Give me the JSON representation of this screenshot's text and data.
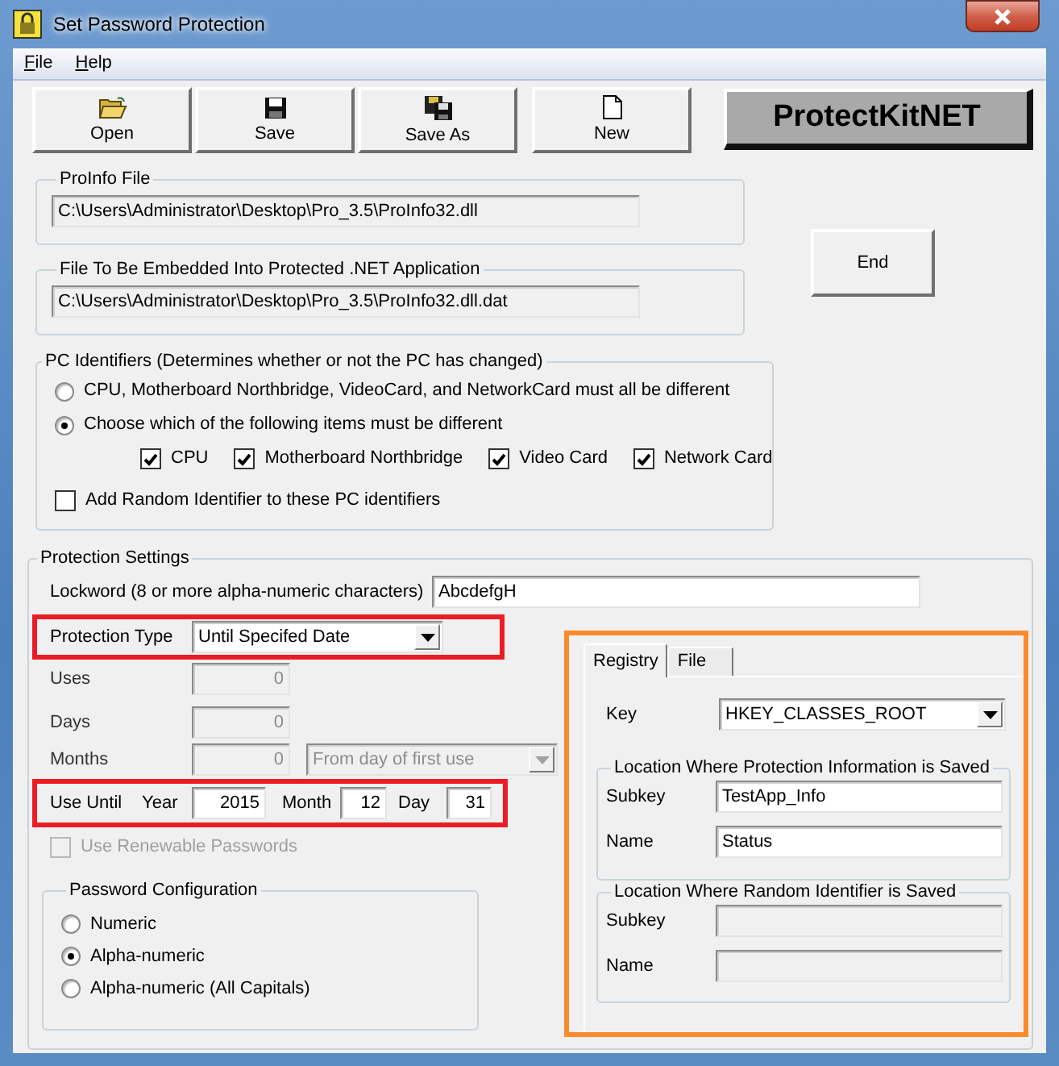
{
  "window": {
    "title": "Set Password Protection"
  },
  "menu": [
    {
      "label": "File"
    },
    {
      "label": "Help"
    }
  ],
  "toolbar": [
    {
      "label": "Open",
      "kind": "open"
    },
    {
      "label": "Save",
      "kind": "save"
    },
    {
      "label": "Save As",
      "kind": "save_as"
    },
    {
      "label": "New",
      "kind": "new"
    }
  ],
  "logo": "ProtectKitNET",
  "proinfo_file": {
    "label": "ProInfo File",
    "value": "C:\\Users\\Administrator\\Desktop\\Pro_3.5\\ProInfo32.dll"
  },
  "embedded_file": {
    "label": "File To Be Embedded Into Protected .NET Application",
    "value": "C:\\Users\\Administrator\\Desktop\\Pro_3.5\\ProInfo32.dll.dat"
  },
  "end_button": "End",
  "pc_identifiers": {
    "label": "PC Identifiers (Determines whether or not the PC has changed)",
    "options": [
      {
        "label": "CPU, Motherboard Northbridge, VideoCard, and NetworkCard must all be different",
        "selected": false
      },
      {
        "label": "Choose which of the following items must be different",
        "selected": true
      }
    ],
    "items": [
      {
        "label": "CPU",
        "checked": true
      },
      {
        "label": "Motherboard Northbridge",
        "checked": true
      },
      {
        "label": "Video Card",
        "checked": true
      },
      {
        "label": "Network Card",
        "checked": true
      }
    ],
    "random_identifier": {
      "label": "Add Random Identifier to these PC identifiers",
      "checked": false
    }
  },
  "protection_settings": {
    "label": "Protection Settings",
    "lockword": {
      "label": "Lockword (8 or more alpha-numeric characters)",
      "value": "AbcdefgH"
    },
    "protection_type": {
      "label": "Protection Type",
      "value": "Until Specifed Date",
      "highlighted": true
    },
    "uses": {
      "label": "Uses",
      "value": "0",
      "disabled": true
    },
    "days": {
      "label": "Days",
      "value": "0",
      "disabled": true
    },
    "months": {
      "label": "Months",
      "value": "0",
      "disabled": true,
      "basis": "From day of first use"
    },
    "use_until": {
      "label": "Use Until",
      "highlighted": true,
      "year_label": "Year",
      "year": "2015",
      "month_label": "Month",
      "month": "12",
      "day_label": "Day",
      "day": "31"
    },
    "renewable": {
      "label": "Use Renewable Passwords",
      "checked": false,
      "disabled": true
    },
    "password_configuration": {
      "label": "Password Configuration",
      "options": [
        {
          "label": "Numeric",
          "selected": false
        },
        {
          "label": "Alpha-numeric",
          "selected": true
        },
        {
          "label": "Alpha-numeric (All Capitals)",
          "selected": false
        }
      ]
    }
  },
  "storage": {
    "highlighted": true,
    "tabs": [
      {
        "label": "Registry",
        "selected": true
      },
      {
        "label": "File",
        "selected": false
      }
    ],
    "key": {
      "label": "Key",
      "value": "HKEY_CLASSES_ROOT"
    },
    "protection_location": {
      "label": "Location Where Protection Information is Saved",
      "subkey": {
        "label": "Subkey",
        "value": "TestApp_Info",
        "disabled": false
      },
      "name": {
        "label": "Name",
        "value": "Status",
        "disabled": false
      }
    },
    "random_location": {
      "label": "Location Where Random Identifier is Saved",
      "subkey": {
        "label": "Subkey",
        "disabled": true
      },
      "name": {
        "label": "Name",
        "disabled": true
      }
    }
  }
}
